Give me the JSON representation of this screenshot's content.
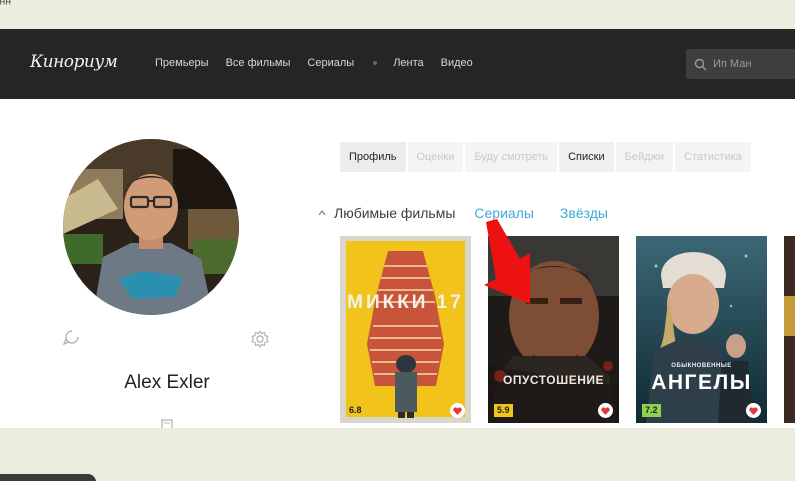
{
  "header": {
    "logo": "Кинориум",
    "nav": [
      "Премьеры",
      "Все фильмы",
      "Сериалы",
      "Лента",
      "Видео"
    ],
    "search_value": "Ип Ман"
  },
  "profile": {
    "name": "Alex Exler"
  },
  "tabs": [
    "Профиль",
    "Оценки",
    "Буду смотреть",
    "Списки",
    "Бейджи",
    "Статистика"
  ],
  "sections": {
    "label": "Любимые фильмы",
    "links": [
      "Сериалы",
      "Звёзды"
    ]
  },
  "posters": [
    {
      "title": "МИККИ 17",
      "rating": "6.8",
      "rating_color": "#f2c31a"
    },
    {
      "title": "ОПУСТОШЕНИЕ",
      "rating": "5.9",
      "rating_color": "#f2c31a"
    },
    {
      "title": "АНГЕЛЫ",
      "subtitle": "ОБЫКНОВЕННЫЕ",
      "rating": "7.2",
      "rating_color": "#8fd14f"
    }
  ],
  "colors": {
    "accent_link": "#3fa8d8",
    "navbar": "#252525",
    "arrow": "#ee1111",
    "heart": "#e23a3a"
  }
}
